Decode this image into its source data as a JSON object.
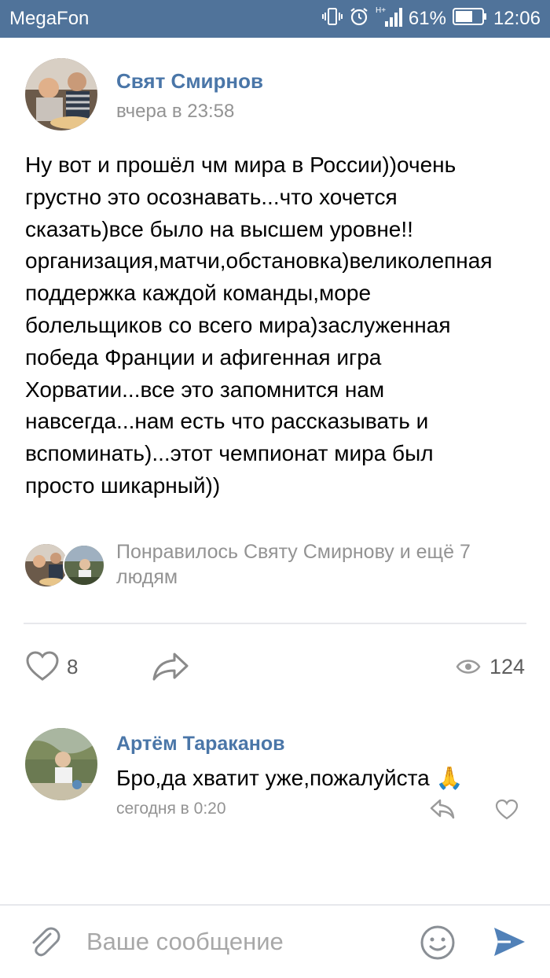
{
  "status_bar": {
    "carrier": "MegaFon",
    "battery_percent": "61%",
    "time": "12:06",
    "network": "H+"
  },
  "post": {
    "author": "Свят Смирнов",
    "time": "вчера в 23:58",
    "text": "Ну вот и прошёл чм мира в России))очень\nгрустно это осознавать...что хочется\nсказать)все было на высшем уровне!!\nорганизация,матчи,обстановка)великолепная\nподдержка каждой команды,море\nболельщиков со всего мира)заслуженная\nпобеда Франции и афигенная игра\nХорватии...все это запомнится нам\nнавсегда...нам есть что рассказывать и\nвспоминать)...этот чемпионат мира был\nпросто шикарный))",
    "likers_text": "Понравилось Святу Смирнову и ещё 7 людям",
    "like_count": "8",
    "views_count": "124",
    "icons": {
      "like": "heart-icon",
      "share": "share-arrow-icon",
      "views": "eye-icon"
    }
  },
  "comment": {
    "author": "Артём Тараканов",
    "text": "Бро,да хватит уже,пожалуйста 🙏",
    "time": "сегодня в 0:20"
  },
  "composer": {
    "placeholder": "Ваше сообщение"
  },
  "colors": {
    "status_bar_bg": "#50739a",
    "link_blue": "#4a76a8",
    "meta_gray": "#939393",
    "send_blue": "#5181b8"
  }
}
